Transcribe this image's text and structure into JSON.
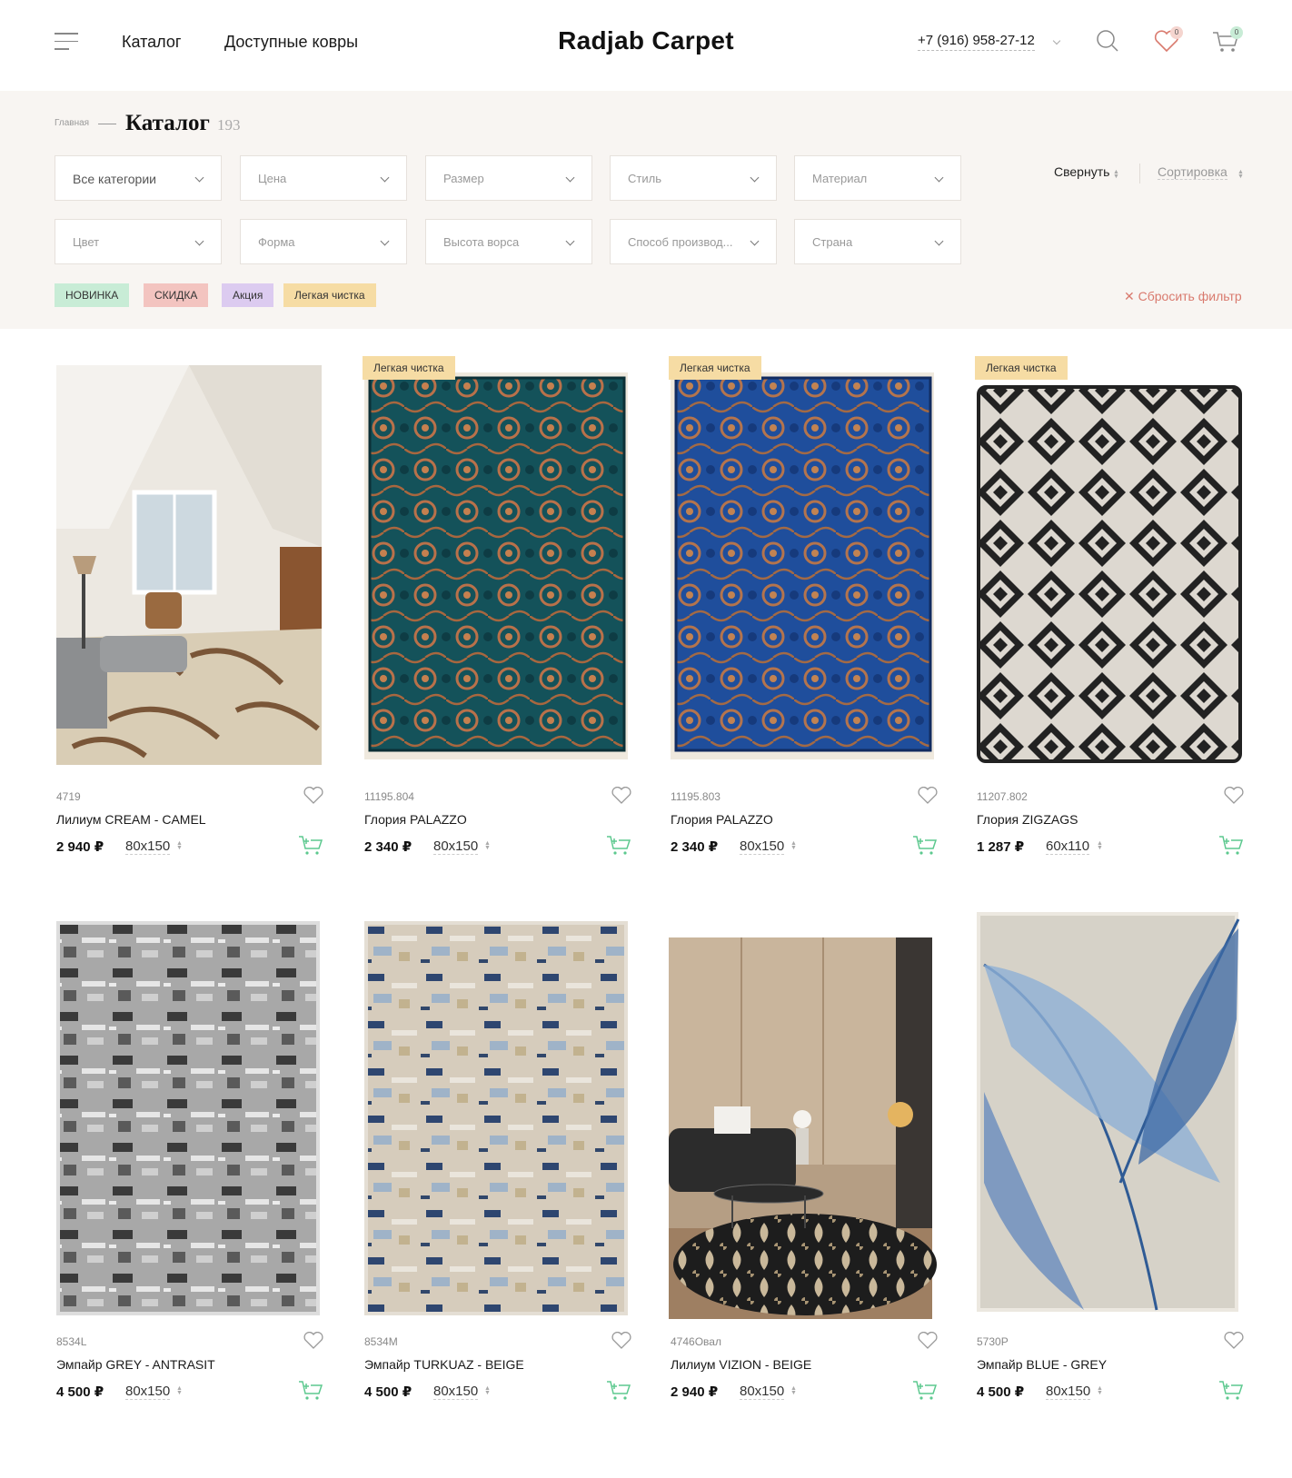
{
  "header": {
    "nav": [
      "Каталог",
      "Доступные ковры"
    ],
    "logo": "Radjab Carpet",
    "phone": "+7 (916) 958-27-12",
    "wishlist_count": "0",
    "cart_count": "0"
  },
  "breadcrumb": {
    "home": "Главная",
    "title": "Каталог",
    "count": "193"
  },
  "filters": {
    "row1": [
      "Все категории",
      "Цена",
      "Размер",
      "Стиль",
      "Материал"
    ],
    "row2": [
      "Цвет",
      "Форма",
      "Высота ворса",
      "Способ производ...",
      "Страна"
    ],
    "collapse": "Свернуть",
    "sorting": "Сортировка",
    "reset": "Сбросить фильтр"
  },
  "tags": [
    {
      "label": "НОВИНКА",
      "color": "#c8ecd6"
    },
    {
      "label": "СКИДКА",
      "color": "#f3c4c0"
    },
    {
      "label": "Акция",
      "color": "#dccbf0"
    },
    {
      "label": "Легкая чистка",
      "color": "#f6dca4"
    }
  ],
  "colors": {
    "accent_green": "#5dc98f",
    "reset_red": "#d97a6e",
    "panel_bg": "#f8f5f2"
  },
  "products": [
    {
      "sku": "4719",
      "name": "Лилиум CREAM - CAMEL",
      "price": "2 940 ₽",
      "size": "80x150",
      "badge": "",
      "image": "room-leaf-rug"
    },
    {
      "sku": "11195.804",
      "name": "Глория PALAZZO",
      "price": "2 340 ₽",
      "size": "80x150",
      "badge": "Легкая чистка",
      "image": "teal-ornate-rug"
    },
    {
      "sku": "11195.803",
      "name": "Глория PALAZZO",
      "price": "2 340 ₽",
      "size": "80x150",
      "badge": "Легкая чистка",
      "image": "blue-ornate-rug"
    },
    {
      "sku": "11207.802",
      "name": "Глория ZIGZAGS",
      "price": "1 287 ₽",
      "size": "60x110",
      "badge": "Легкая чистка",
      "image": "diamond-rug"
    },
    {
      "sku": "8534L",
      "name": "Эмпайр GREY - ANTRASIT",
      "price": "4 500 ₽",
      "size": "80x150",
      "badge": "",
      "image": "grey-abstract-rug"
    },
    {
      "sku": "8534M",
      "name": "Эмпайр TURKUAZ - BEIGE",
      "price": "4 500 ₽",
      "size": "80x150",
      "badge": "",
      "image": "beige-abstract-rug"
    },
    {
      "sku": "4746Овал",
      "name": "Лилиум VIZION - BEIGE",
      "price": "2 940 ₽",
      "size": "80x150",
      "badge": "",
      "image": "living-room-oval-rug"
    },
    {
      "sku": "5730P",
      "name": "Эмпайр BLUE - GREY",
      "price": "4 500 ₽",
      "size": "80x150",
      "badge": "",
      "image": "feather-rug"
    }
  ]
}
